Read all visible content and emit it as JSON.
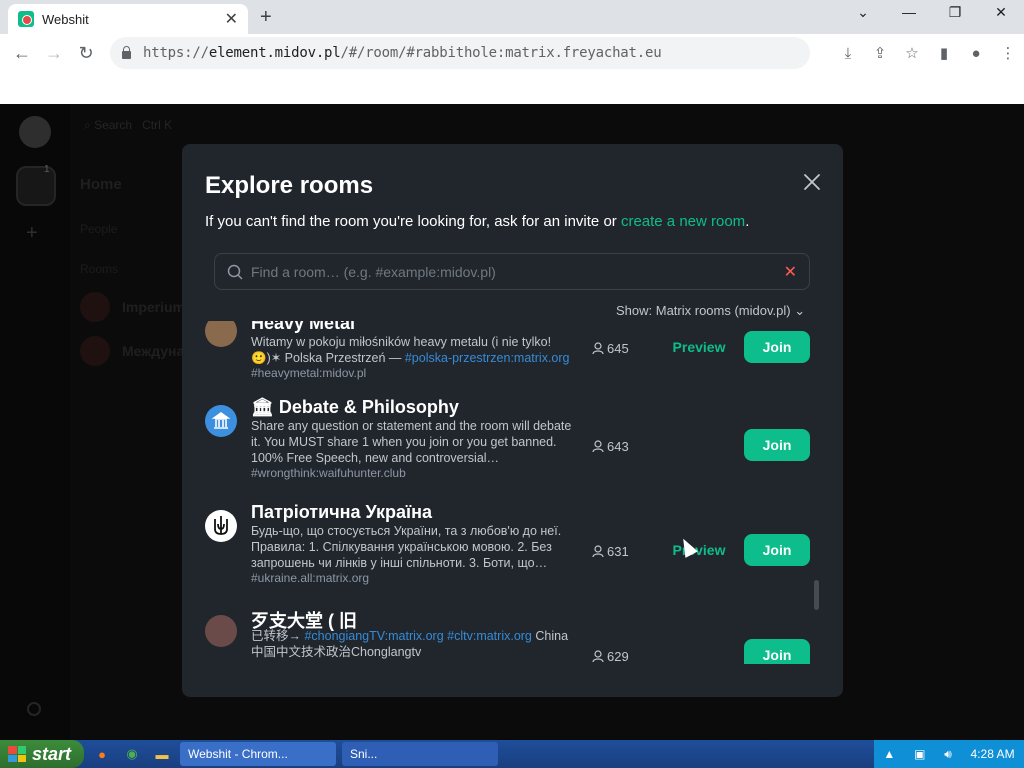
{
  "browser": {
    "tab_title": "Webshit",
    "new_tab": "+",
    "url_prefix": "https://",
    "url_host": "element.midov.pl",
    "url_path": "/#/room/#rabbithole:matrix.freyachat.eu",
    "window_controls": [
      "⌄",
      "—",
      "❐",
      "✕"
    ]
  },
  "app": {
    "left_panel": {
      "search": "Search",
      "search_shortcut": "Ctrl K",
      "home": "Home",
      "badge": "1",
      "section_people": "People",
      "section_rooms": "Rooms",
      "rooms": [
        "Imperium",
        "Междуна"
      ]
    }
  },
  "dialog": {
    "title": "Explore rooms",
    "subtitle_text": "If you can't find the room you're looking for, ask for an invite or ",
    "subtitle_link": "create a new room",
    "subtitle_end": ".",
    "search_placeholder": "Find a room… (e.g. #example:midov.pl)",
    "show_filter": "Show: Matrix rooms (midov.pl)",
    "preview_label": "Preview",
    "join_label": "Join",
    "rooms": [
      {
        "name": "Heavy Metal",
        "topic_plain": "Witamy w pokoju miłośników heavy metalu (i nie tylko! 🙂)✶ Polska Przestrzeń — ",
        "topic_link": "#polska-przestrzen:matrix.org",
        "alias": "#heavymetal:midov.pl",
        "members": "645",
        "has_preview": true
      },
      {
        "name": "🏛 Debate & Philosophy",
        "topic_plain": "Share any question or statement and the room will debate it. You MUST share 1 when you join or you get banned. 100% Free Speech, new and controversial…",
        "topic_link": "",
        "alias": "#wrongthink:waifuhunter.club",
        "members": "643",
        "has_preview": false
      },
      {
        "name": "Патріотична Україна",
        "topic_plain": "Будь-що, що стосується України, та з любов'ю до неї. Правила: 1. Спілкування українською мовою. 2. Без запрошень чи лінків у інші спільноти. 3. Боти, що…",
        "topic_link": "",
        "alias": "#ukraine.all:matrix.org",
        "members": "631",
        "has_preview": true
      },
      {
        "name": "歹支大堂 ( 旧",
        "topic_plain": "已转移→ ",
        "topic_link": "#chongiangTV:matrix.org #cltv:matrix.org",
        "topic_after": " China 中国中文技术政治Chonglangtv",
        "alias": "",
        "members": "629",
        "has_preview": false
      }
    ]
  },
  "taskbar": {
    "start": "start",
    "tasks": [
      "Webshit - Chrom...",
      "Sni..."
    ],
    "clock": "4:28 AM"
  },
  "colors": {
    "accent": "#0dbd8b",
    "link": "#368bd6",
    "dialog_bg": "#21262c"
  }
}
